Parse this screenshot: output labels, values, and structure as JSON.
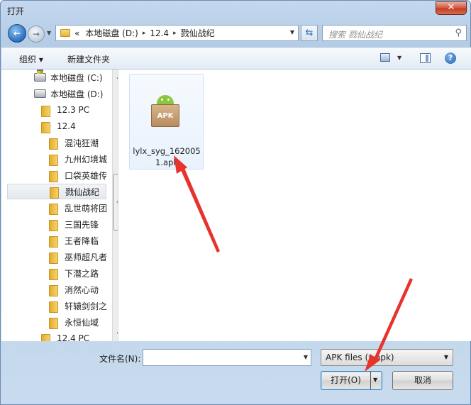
{
  "window": {
    "title": "打开",
    "close_label": "✕"
  },
  "address": {
    "prefix": "«",
    "crumbs": [
      "本地磁盘 (D:)",
      "12.4",
      "戮仙战纪"
    ],
    "separator": "▸",
    "search_placeholder": "搜索 戮仙战纪"
  },
  "toolbar": {
    "organize": "组织 ▾",
    "new_folder": "新建文件夹",
    "help": "?"
  },
  "nav": {
    "items": [
      {
        "label": "本地磁盘 (C:)",
        "type": "drive"
      },
      {
        "label": "本地磁盘 (D:)",
        "type": "drive"
      },
      {
        "label": "12.3 PC",
        "type": "folder"
      },
      {
        "label": "12.4",
        "type": "folder"
      },
      {
        "label": "混沌狂潮",
        "type": "folder"
      },
      {
        "label": "九州幻境城",
        "type": "folder"
      },
      {
        "label": "口袋英雄传",
        "type": "folder"
      },
      {
        "label": "戮仙战纪",
        "type": "folder",
        "selected": true
      },
      {
        "label": "乱世萌将团",
        "type": "folder"
      },
      {
        "label": "三国先锋",
        "type": "folder"
      },
      {
        "label": "王者降临",
        "type": "folder"
      },
      {
        "label": "巫师超凡者",
        "type": "folder"
      },
      {
        "label": "下潜之路",
        "type": "folder"
      },
      {
        "label": "消然心动",
        "type": "folder"
      },
      {
        "label": "轩辕剑剑之",
        "type": "folder"
      },
      {
        "label": "永恒仙域",
        "type": "folder"
      },
      {
        "label": "12.4 PC",
        "type": "folder"
      }
    ]
  },
  "files": [
    {
      "name": "lylx_syg_1620051.apk",
      "name_line1": "lylx_syg_162005",
      "name_line2": "1.apk",
      "badge": "APK"
    }
  ],
  "footer": {
    "filename_label": "文件名(N):",
    "filename_value": "",
    "filter_value": "APK files (*.apk)",
    "open_label": "打开(O)",
    "cancel_label": "取消"
  },
  "colors": {
    "arrow": "#e8322c",
    "accent": "#2b6fbf"
  }
}
